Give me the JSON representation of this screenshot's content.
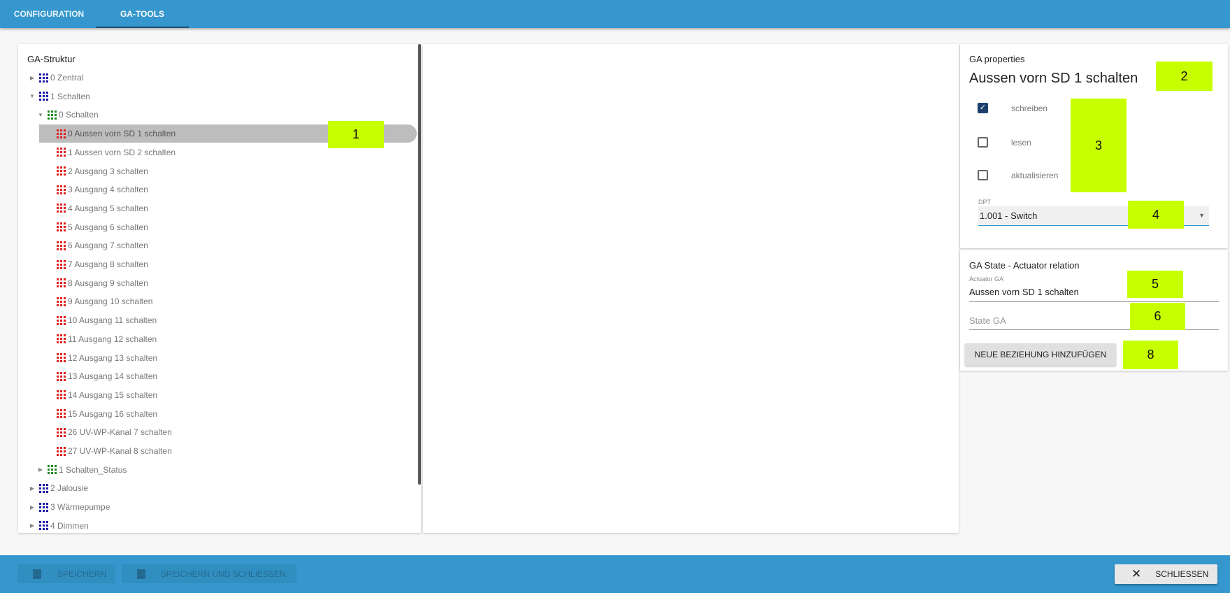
{
  "tabs": [
    {
      "label": "CONFIGURATION",
      "active": false
    },
    {
      "label": "GA-TOOLS",
      "active": true
    }
  ],
  "tree": {
    "title": "GA-Struktur",
    "rows": [
      {
        "label": "0 Zentral",
        "level": 0,
        "expander": "collapsed",
        "icon": "blue"
      },
      {
        "label": "1 Schalten",
        "level": 0,
        "expander": "expanded",
        "icon": "blue"
      },
      {
        "label": "0 Schalten",
        "level": 1,
        "expander": "expanded",
        "icon": "green"
      },
      {
        "label": "0 Aussen vorn SD 1 schalten",
        "level": 2,
        "icon": "red",
        "selected": true
      },
      {
        "label": "1 Aussen vorn SD 2 schalten",
        "level": 2,
        "icon": "red"
      },
      {
        "label": "2 Ausgang 3 schalten",
        "level": 2,
        "icon": "red"
      },
      {
        "label": "3 Ausgang 4 schalten",
        "level": 2,
        "icon": "red"
      },
      {
        "label": "4 Ausgang 5 schalten",
        "level": 2,
        "icon": "red"
      },
      {
        "label": "5 Ausgang 6 schalten",
        "level": 2,
        "icon": "red"
      },
      {
        "label": "6 Ausgang 7 schalten",
        "level": 2,
        "icon": "red"
      },
      {
        "label": "7 Ausgang 8 schalten",
        "level": 2,
        "icon": "red"
      },
      {
        "label": "8 Ausgang 9 schalten",
        "level": 2,
        "icon": "red"
      },
      {
        "label": "9 Ausgang 10 schalten",
        "level": 2,
        "icon": "red"
      },
      {
        "label": "10 Ausgang 11 schalten",
        "level": 2,
        "icon": "red"
      },
      {
        "label": "11 Ausgang 12 schalten",
        "level": 2,
        "icon": "red"
      },
      {
        "label": "12 Ausgang 13 schalten",
        "level": 2,
        "icon": "red"
      },
      {
        "label": "13 Ausgang 14 schalten",
        "level": 2,
        "icon": "red"
      },
      {
        "label": "14 Ausgang 15 schalten",
        "level": 2,
        "icon": "red"
      },
      {
        "label": "15 Ausgang 16 schalten",
        "level": 2,
        "icon": "red"
      },
      {
        "label": "26 UV-WP-Kanal 7 schalten",
        "level": 2,
        "icon": "red"
      },
      {
        "label": "27 UV-WP-Kanal 8 schalten",
        "level": 2,
        "icon": "red"
      },
      {
        "label": "1 Schalten_Status",
        "level": 1,
        "expander": "collapsed",
        "icon": "green"
      },
      {
        "label": "2 Jalousie",
        "level": 0,
        "expander": "collapsed",
        "icon": "blue"
      },
      {
        "label": "3 Wärmepumpe",
        "level": 0,
        "expander": "collapsed",
        "icon": "blue"
      },
      {
        "label": "4 Dimmen",
        "level": 0,
        "expander": "collapsed",
        "icon": "blue"
      }
    ]
  },
  "colors": {
    "blue": "#1a1aa8",
    "green": "#1f8a1f",
    "red": "#e02020",
    "bar": "#3597cd",
    "marker": "#c8ff00"
  },
  "properties": {
    "heading": "GA properties",
    "title": "Aussen vorn SD 1 schalten",
    "checkboxes": [
      {
        "label": "schreiben",
        "checked": true
      },
      {
        "label": "lesen",
        "checked": false
      },
      {
        "label": "aktualisieren",
        "checked": false
      }
    ],
    "dpt_label": "DPT",
    "dpt_value": "1.001 - Switch"
  },
  "relation": {
    "heading": "GA State - Actuator relation",
    "actuator_label": "Actuator GA",
    "actuator_value": "Aussen vorn SD 1 schalten",
    "state_placeholder": "State GA",
    "add_button": "NEUE BEZIEHUNG HINZUFÜGEN"
  },
  "markers": [
    "1",
    "2",
    "3",
    "4",
    "5",
    "6",
    "8"
  ],
  "footer": {
    "save": "SPEICHERN",
    "save_close": "SPEICHERN UND SCHLIESSEN",
    "close": "SCHLIESSEN"
  }
}
